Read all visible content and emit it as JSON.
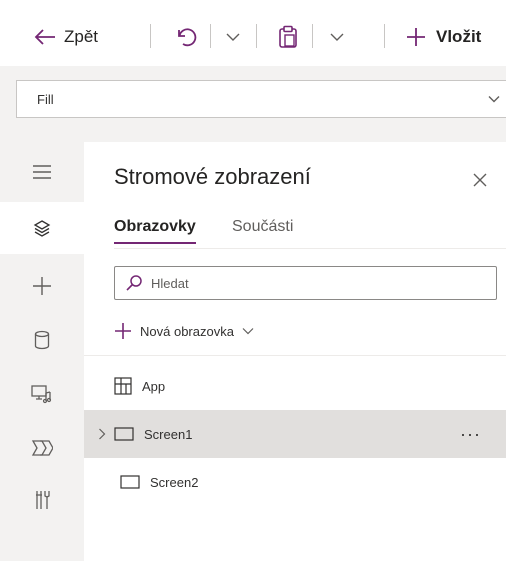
{
  "toolbar": {
    "back_label": "Zpět",
    "insert_label": "Vložit",
    "icons": [
      "back-arrow-icon",
      "undo-icon",
      "chevron-down-icon",
      "paste-icon",
      "chevron-down-icon",
      "plus-icon"
    ]
  },
  "formula_bar": {
    "property_value": "Fill"
  },
  "rail": {
    "items": [
      "hamburger-menu-icon",
      "layers-icon",
      "plus-icon",
      "database-icon",
      "media-icon",
      "advanced-tools-icon",
      "tools-icon"
    ],
    "active_index": 1
  },
  "tree_view": {
    "title": "Stromové zobrazení",
    "tabs": [
      {
        "label": "Obrazovky",
        "active": true
      },
      {
        "label": "Součásti",
        "active": false
      }
    ],
    "search": {
      "placeholder": "Hledat",
      "value": ""
    },
    "new_screen_label": "Nová obrazovka",
    "items": [
      {
        "label": "App",
        "icon": "app-grid-icon",
        "selected": false
      },
      {
        "label": "Screen1",
        "icon": "screen-icon",
        "selected": true,
        "expandable": true,
        "more_label": "···"
      },
      {
        "label": "Screen2",
        "icon": "screen-icon",
        "selected": false
      }
    ]
  },
  "colors": {
    "accent": "#742774",
    "selected_row": "#e1dfdd",
    "rail_background": "#f3f2f1"
  }
}
